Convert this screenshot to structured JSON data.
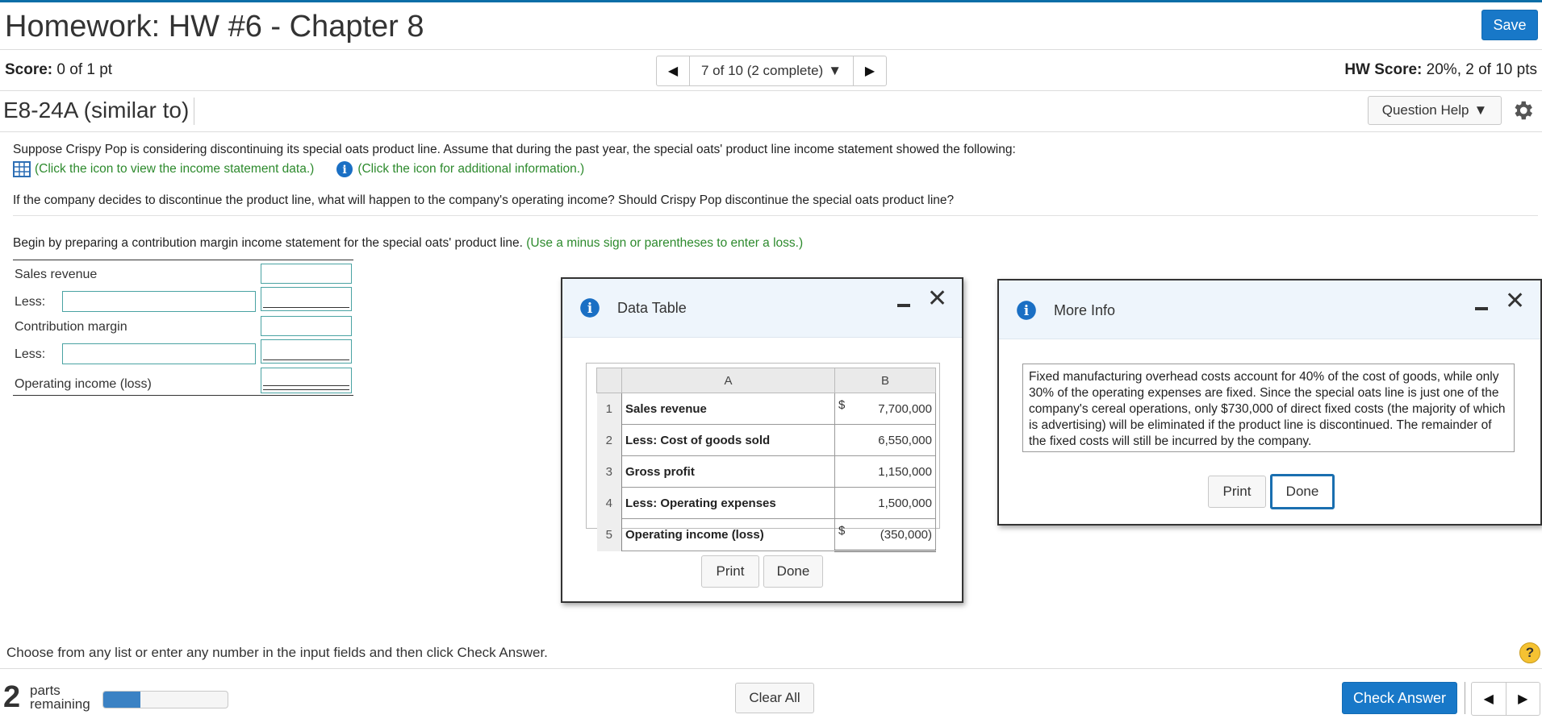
{
  "header": {
    "title": "Homework: HW #6 - Chapter 8",
    "save_label": "Save"
  },
  "score": {
    "label": "Score:",
    "value": "0 of 1 pt",
    "nav_text": "7 of 10 (2 complete)",
    "hw_label": "HW Score:",
    "hw_value": "20%, 2 of 10 pts"
  },
  "question": {
    "id": "E8-24A (similar to)",
    "help_label": "Question Help",
    "intro": "Suppose Crispy Pop is considering discontinuing its special oats product line. Assume that during the past year, the special oats' product line income statement showed the following:",
    "data_link": "(Click the icon to view the income statement data.)",
    "info_link": "(Click the icon for additional information.)",
    "prompt": "If the company decides to discontinue the product line, what will happen to the company's operating income? Should Crispy Pop discontinue the special oats product line?",
    "instruction": "Begin by preparing a contribution margin income statement for the special oats' product line.",
    "instruction_hint": "(Use a minus sign or parentheses to enter a loss.)"
  },
  "statement": {
    "rows": [
      {
        "label": "Sales revenue"
      },
      {
        "label": "Less:"
      },
      {
        "label": "Contribution margin"
      },
      {
        "label": "Less:"
      },
      {
        "label": "Operating income (loss)"
      }
    ]
  },
  "data_table": {
    "title": "Data Table",
    "col_a": "A",
    "col_b": "B",
    "rows": [
      {
        "num": "1",
        "label": "Sales revenue",
        "cur": "$",
        "value": "7,700,000"
      },
      {
        "num": "2",
        "label": "Less: Cost of goods sold",
        "cur": "",
        "value": "6,550,000"
      },
      {
        "num": "3",
        "label": "Gross profit",
        "cur": "",
        "value": "1,150,000"
      },
      {
        "num": "4",
        "label": "Less: Operating expenses",
        "cur": "",
        "value": "1,500,000"
      },
      {
        "num": "5",
        "label": "Operating income (loss)",
        "cur": "$",
        "value": "(350,000)"
      }
    ],
    "print_label": "Print",
    "done_label": "Done"
  },
  "more_info": {
    "title": "More Info",
    "text": "Fixed manufacturing overhead costs account for 40% of the cost of goods, while only 30% of the operating expenses are fixed. Since the special oats line is just one of the company's cereal operations, only $730,000 of direct fixed costs (the majority of which is advertising) will be eliminated if the product line is discontinued. The remainder of the fixed costs will still be incurred by the company.",
    "print_label": "Print",
    "done_label": "Done"
  },
  "footer": {
    "hint": "Choose from any list or enter any number in the input fields and then click Check Answer.",
    "help_symbol": "?",
    "parts_count": "2",
    "parts_line1": "parts",
    "parts_line2": "remaining",
    "progress_fraction": 0.3,
    "clear_label": "Clear All",
    "check_label": "Check Answer"
  },
  "colors": {
    "accent": "#1878c8",
    "link_green": "#2d8a2d",
    "input_border": "#4aa3a3"
  }
}
